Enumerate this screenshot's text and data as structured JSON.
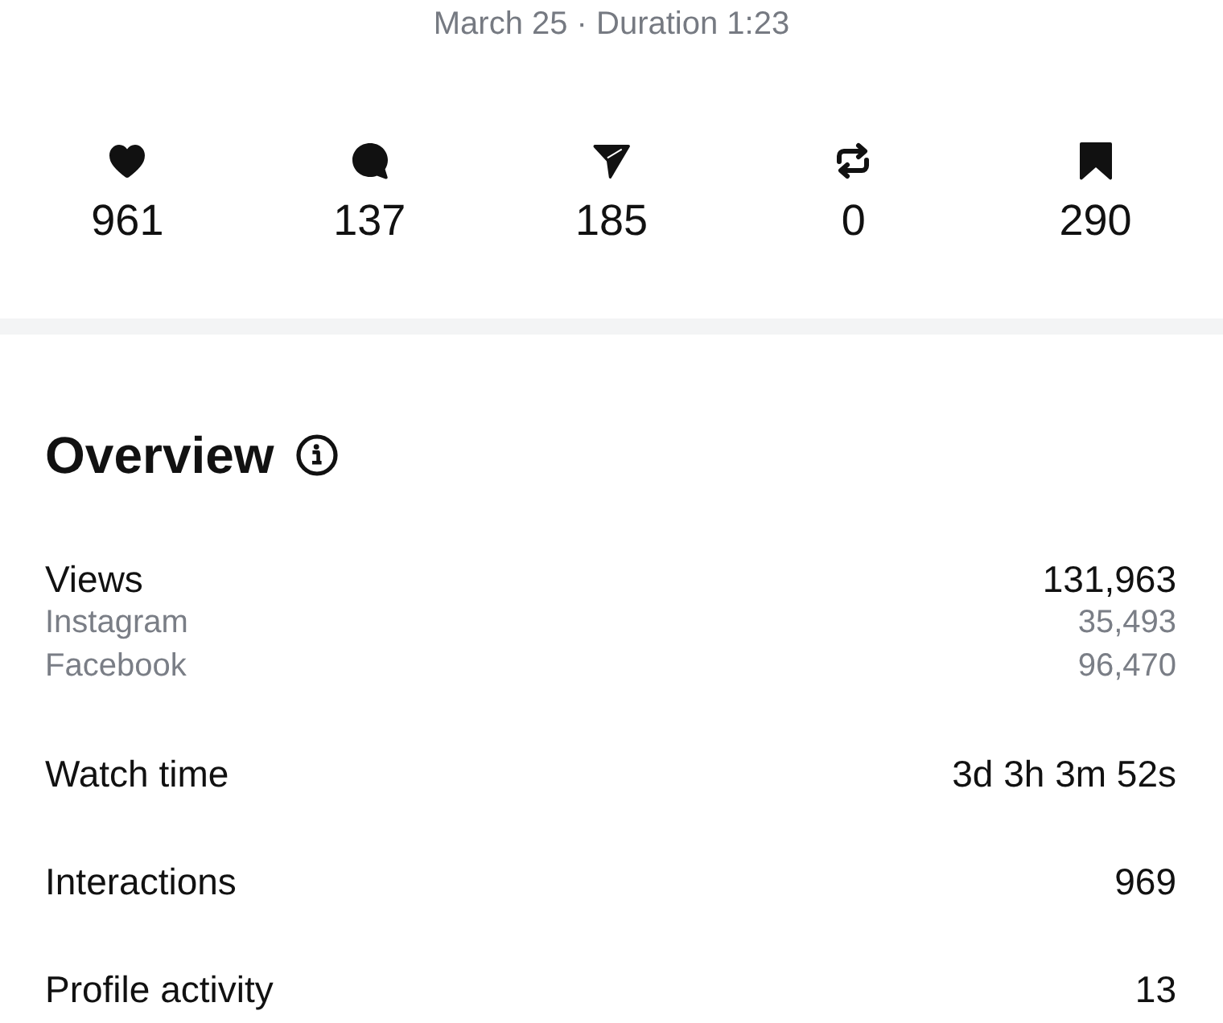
{
  "header": {
    "subtitle": "March 25 · Duration 1:23"
  },
  "stats": [
    {
      "kind": "like",
      "value": "961"
    },
    {
      "kind": "comment",
      "value": "137"
    },
    {
      "kind": "share",
      "value": "185"
    },
    {
      "kind": "repost",
      "value": "0"
    },
    {
      "kind": "save",
      "value": "290"
    }
  ],
  "overview": {
    "title": "Overview",
    "metrics": [
      {
        "label": "Views",
        "value": "131,963",
        "breakdown": [
          {
            "label": "Instagram",
            "value": "35,493"
          },
          {
            "label": "Facebook",
            "value": "96,470"
          }
        ]
      },
      {
        "label": "Watch time",
        "value": "3d 3h 3m 52s"
      },
      {
        "label": "Interactions",
        "value": "969"
      },
      {
        "label": "Profile activity",
        "value": "13"
      }
    ]
  }
}
